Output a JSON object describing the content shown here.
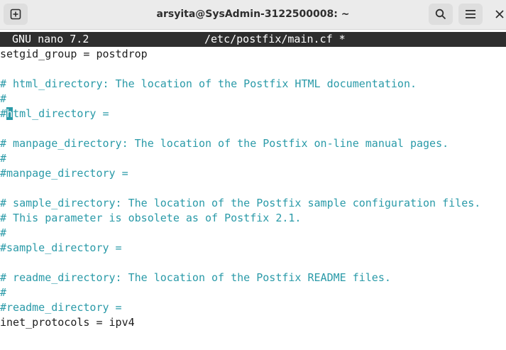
{
  "window": {
    "title": "arsyita@SysAdmin-3122500008: ~"
  },
  "icons": {
    "new_tab": "new-tab-icon",
    "search": "search-icon",
    "menu": "hamburger-menu-icon",
    "close": "close-icon"
  },
  "nano": {
    "version": "GNU nano 7.2",
    "filename": "/etc/postfix/main.cf *"
  },
  "editor": {
    "line_setgid": "setgid_group = postdrop",
    "line_html_comment": "# html_directory: The location of the Postfix HTML documentation.",
    "line_hash_1": "#",
    "line_html_setting_before_cursor": "#",
    "line_html_setting_cursor_char": "h",
    "line_html_setting_after_cursor": "tml_directory =",
    "line_manpage_comment": "# manpage_directory: The location of the Postfix on-line manual pages.",
    "line_hash_2": "#",
    "line_manpage_setting": "#manpage_directory =",
    "line_sample_comment": "# sample_directory: The location of the Postfix sample configuration files.",
    "line_sample_obsolete": "# This parameter is obsolete as of Postfix 2.1.",
    "line_hash_3": "#",
    "line_sample_setting": "#sample_directory =",
    "line_readme_comment": "# readme_directory: The location of the Postfix README files.",
    "line_hash_4": "#",
    "line_readme_setting": "#readme_directory =",
    "line_inet": "inet_protocols = ipv4"
  },
  "colors": {
    "comment": "#2a9aa8",
    "text": "#1e1e1e",
    "header_bg": "#2e2e2e",
    "titlebar_bg": "#ebebeb"
  }
}
